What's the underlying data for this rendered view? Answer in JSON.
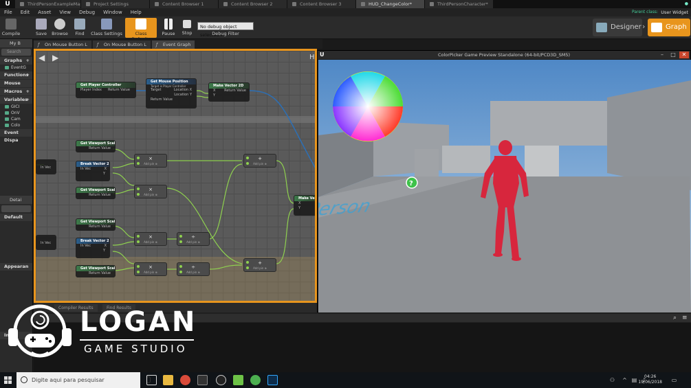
{
  "tabs": [
    "ThirdPersonExampleMap*",
    "Project Settings",
    "Content Browser 1",
    "Content Browser 2",
    "Content Browser 3",
    "HUD_ChangeColor*",
    "ThirdPersonCharacter*"
  ],
  "menu": [
    "File",
    "Edit",
    "Asset",
    "View",
    "Debug",
    "Window",
    "Help"
  ],
  "header": {
    "parent_class": "Parent class:",
    "user_widget": "User Widget"
  },
  "toolbar": {
    "compile": "Compile",
    "save": "Save",
    "browse": "Browse",
    "find": "Find",
    "class_settings": "Class Settings",
    "class_defaults": "Class Defaults",
    "pause": "Pause",
    "stop": "Stop",
    "debug_select": "No debug object selected ▾",
    "debug_filter": "Debug Filter",
    "designer": "Designer",
    "graph": "Graph"
  },
  "left_panel": {
    "tab": "My B",
    "search": "Search",
    "sections": {
      "graphs": "Graphs",
      "functions": "Functions",
      "mouse": "Mouse",
      "macros": "Macros",
      "variables": "Variables",
      "event_dispatchers": "Event Dispa"
    },
    "items": {
      "event_graph": "EventG",
      "v1": "GICI",
      "v2": "OnV",
      "v3": "Cam",
      "v4": "Colo"
    },
    "details_tab": "Detai",
    "details_default": "Default",
    "details_appearance": "Appearan",
    "details_input": "Input"
  },
  "graph_tabs": [
    "On Mouse Button L",
    "On Mouse Button L",
    "Event Graph"
  ],
  "graph": {
    "hud_label": "HU",
    "nodes": {
      "gpc_title": "Get Player Controller",
      "gpc_in": "Player Index",
      "gpc_out": "Return Value",
      "gmp_title": "Get Mouse Position",
      "gmp_sub": "Target is Player Controller",
      "gmp_target": "Target",
      "gmp_lx": "Location X",
      "gmp_ly": "Location Y",
      "gmp_ret": "Return Value",
      "mv_title": "Make Vector 2D",
      "mv_x": "X",
      "mv_y": "Y",
      "mv_ret": "Return Value",
      "gvs_title": "Get Viewport Scale",
      "gvs_ret": "Return Value",
      "bv_title": "Break Vector 2D",
      "bv_in": "In Vec",
      "bv_x": "X",
      "bv_y": "Y",
      "mv2_title": "Make Vecto",
      "op_x": "×",
      "op_div": "÷",
      "op_plus": "+",
      "op_sub": "Add pin ⊕"
    }
  },
  "preview": {
    "title": "ColorPicker Game Preview Standalone (64-bit/PCD3D_SM5)",
    "min": "–",
    "max": "□",
    "close": "✕",
    "floor_text": "Third Person",
    "help_icon": "?"
  },
  "bottom": {
    "compiler_results": "Compiler Results",
    "find_results": "Find Results",
    "search_icon": "⌕",
    "menu_icon": "≡"
  },
  "watermark": {
    "brand": "LOGAN",
    "sub": "GAME STUDIO"
  },
  "taskbar": {
    "search_placeholder": "Digite aqui para pesquisar",
    "time": "04:26",
    "date": "19/06/2018"
  },
  "colors": {
    "accent": "#e8951d",
    "node_green": "#3d7a4a",
    "wire_green": "#8fd14f",
    "wire_blue": "#2c6fb5",
    "character_red": "#d7263d"
  }
}
